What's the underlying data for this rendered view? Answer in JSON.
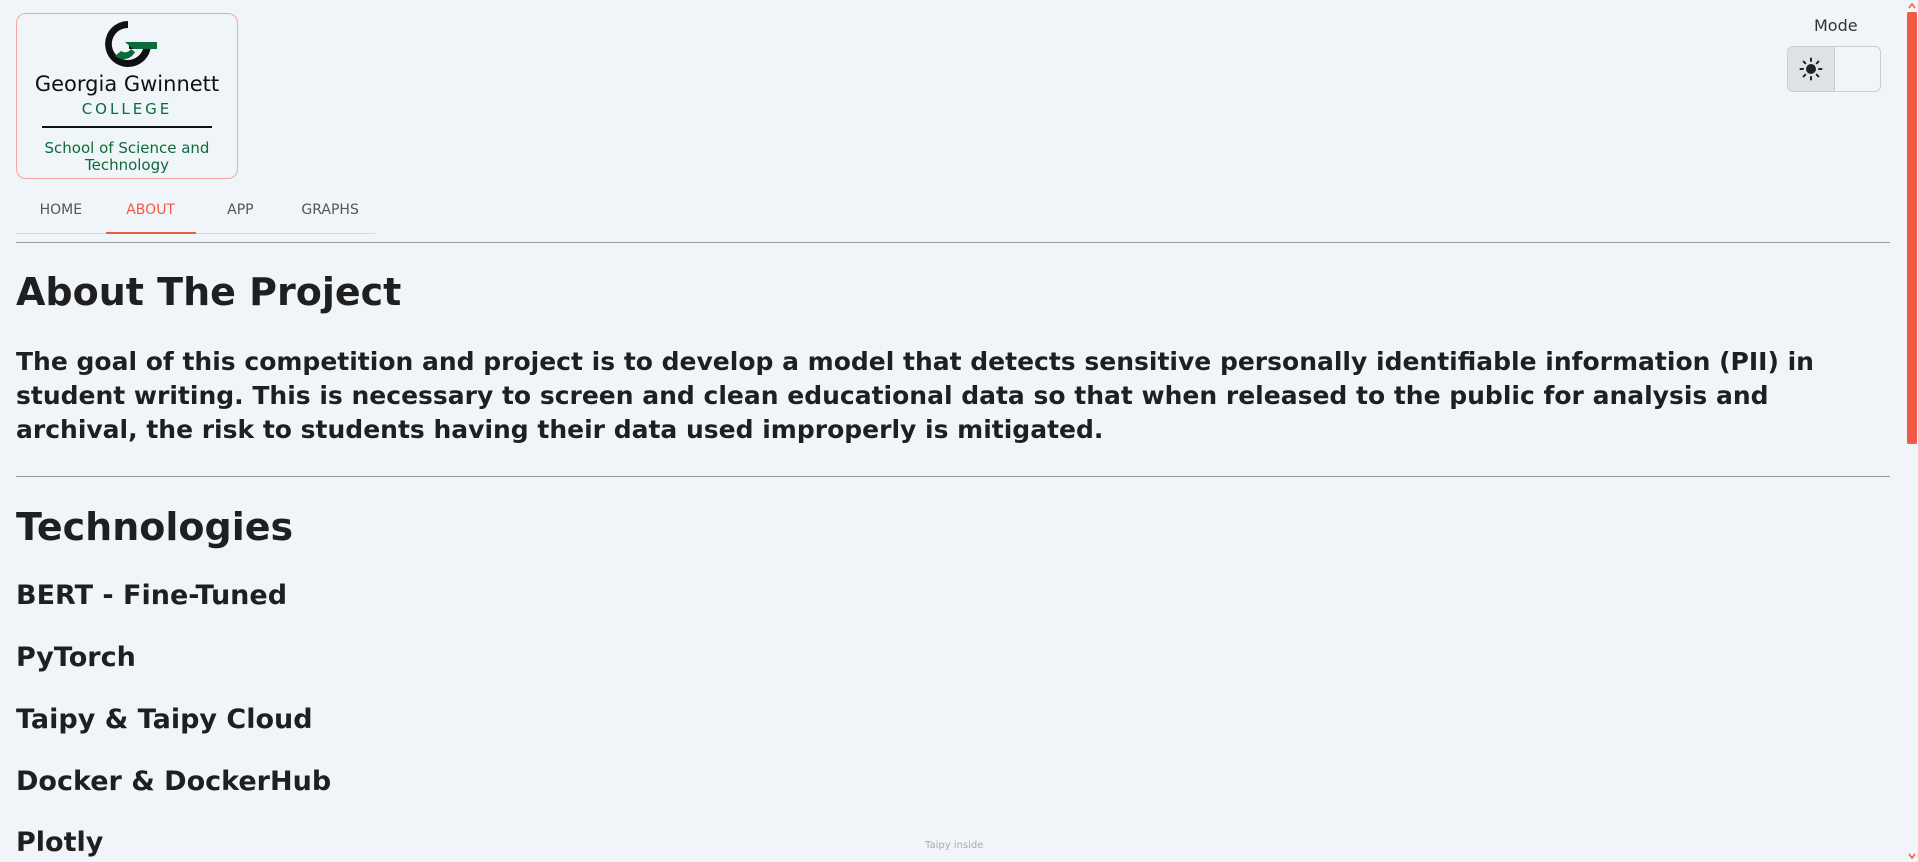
{
  "logo": {
    "name": "Georgia Gwinnett",
    "college": "COLLEGE",
    "school": "School of Science and Technology",
    "colors": {
      "green": "#0b6b3a",
      "black": "#111111"
    }
  },
  "mode": {
    "label": "Mode",
    "options": [
      {
        "icon": "sun-icon",
        "glyph": "☀",
        "active": true
      },
      {
        "icon": "moon-icon",
        "glyph": "☽",
        "active": false
      }
    ]
  },
  "tabs": [
    {
      "label": "HOME",
      "active": false
    },
    {
      "label": "ABOUT",
      "active": true
    },
    {
      "label": "APP",
      "active": false
    },
    {
      "label": "GRAPHS",
      "active": false
    }
  ],
  "about": {
    "title": "About The Project",
    "body": "The goal of this competition and project is to develop a model that detects sensitive personally identifiable information (PII) in student writing. This is necessary to screen and clean educational data so that when released to the public for analysis and archival, the risk to students having their data used improperly is mitigated."
  },
  "technologies": {
    "title": "Technologies",
    "items": [
      "BERT - Fine-Tuned",
      "PyTorch",
      "Taipy & Taipy Cloud",
      "Docker & DockerHub",
      "Plotly"
    ]
  },
  "footer": {
    "tag": "Taipy inside"
  },
  "theme": {
    "accent": "#f15a45",
    "background": "#f0f5f9"
  }
}
